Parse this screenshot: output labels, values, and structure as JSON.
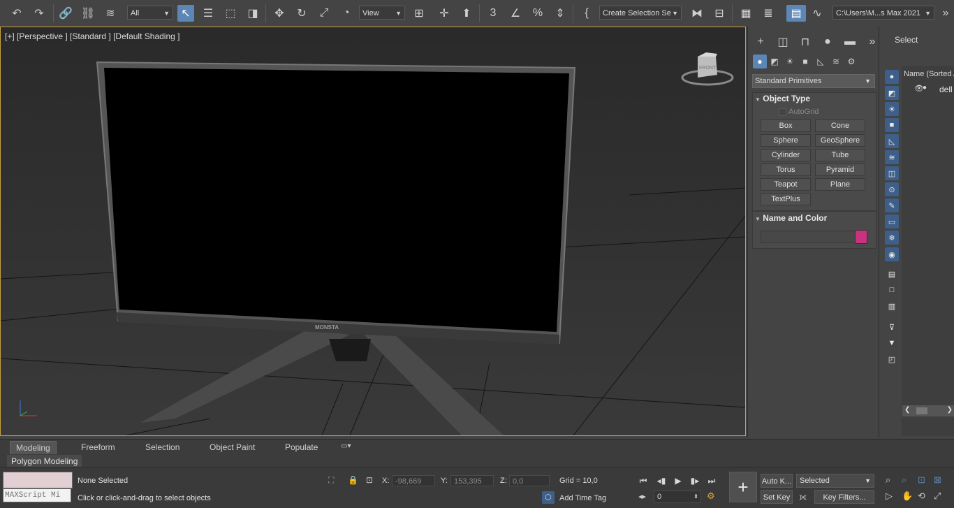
{
  "toolbar": {
    "selection_filter": "All",
    "ref_coord": "View",
    "named_selection": "Create Selection Se",
    "project_path": "C:\\Users\\M...s Max 2021",
    "icons": [
      "undo-icon",
      "redo-icon",
      "link-icon",
      "unlink-icon",
      "bind-spacewarp-icon",
      "select-object-icon",
      "select-by-name-icon",
      "rect-region-icon",
      "window-crossing-icon",
      "move-icon",
      "rotate-icon",
      "scale-icon",
      "placement-icon",
      "pivot-icon",
      "snap-3-icon",
      "angle-snap-icon",
      "percent-snap-icon",
      "spinner-snap-icon",
      "edit-named-selection-icon",
      "mirror-icon",
      "align-icon",
      "scene-explorer-icon",
      "layer-explorer-icon",
      "toggle-ribbon-icon",
      "curve-editor-icon",
      "more-icon"
    ]
  },
  "viewport": {
    "label": "[+] [Perspective ] [Standard ] [Default Shading ]",
    "viewcube_label": "FRONT",
    "monitor_brand": "MONSTA"
  },
  "command_panel": {
    "category": "Standard Primitives",
    "object_type": {
      "title": "Object Type",
      "autogrid": "AutoGrid",
      "buttons": [
        "Box",
        "Cone",
        "Sphere",
        "GeoSphere",
        "Cylinder",
        "Tube",
        "Torus",
        "Pyramid",
        "Teapot",
        "Plane",
        "TextPlus"
      ]
    },
    "name_and_color": {
      "title": "Name and Color",
      "name_value": "",
      "color": "#c8327f"
    }
  },
  "explorer": {
    "select_label": "Select",
    "column_header": "Name (Sorted A",
    "item": "dell"
  },
  "ribbon": {
    "tabs": [
      "Modeling",
      "Freeform",
      "Selection",
      "Object Paint",
      "Populate"
    ],
    "active_tab": "Modeling",
    "sub_tab": "Polygon Modeling"
  },
  "status": {
    "maxscript_placeholder": "MAXScript Mi",
    "selection": "None Selected",
    "prompt": "Click or click-and-drag to select objects",
    "x_label": "X:",
    "x_value": "-98,669",
    "y_label": "Y:",
    "y_value": "153,395",
    "z_label": "Z:",
    "z_value": "0,0",
    "grid": "Grid = 10,0",
    "add_time_tag": "Add Time Tag",
    "frame": "0",
    "auto_key": "Auto K...",
    "set_key": "Set Key",
    "key_mode": "Selected",
    "key_filters": "Key Filters..."
  },
  "colors": {
    "accent": "#5b86b5",
    "viewport_border": "#c8a041"
  }
}
